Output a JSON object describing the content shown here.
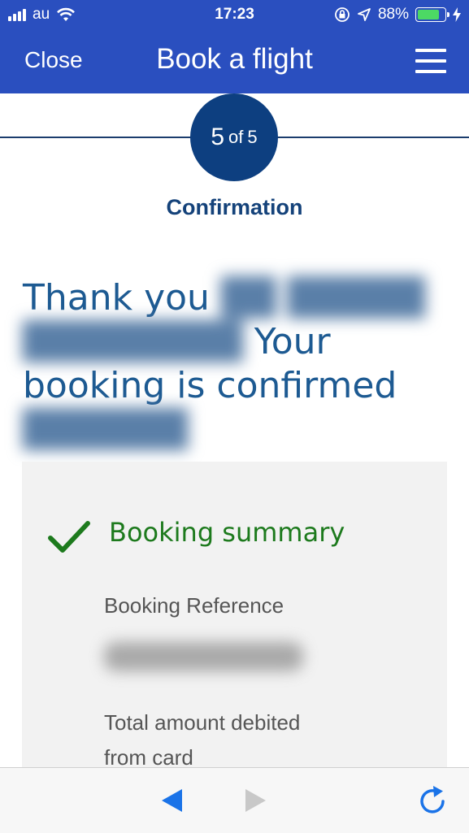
{
  "status_bar": {
    "carrier": "au",
    "time": "17:23",
    "battery_percent": "88%",
    "battery_level": 0.88,
    "icons": [
      "signal-icon",
      "wifi-icon",
      "rotation-lock-icon",
      "location-arrow-icon",
      "battery-icon",
      "charging-bolt-icon"
    ]
  },
  "nav": {
    "close_label": "Close",
    "title": "Book a flight",
    "menu_icon": "hamburger-menu-icon"
  },
  "step": {
    "current": "5",
    "of_label": "of",
    "total": "5",
    "label": "Confirmation"
  },
  "thanks": {
    "text_start": "Thank you",
    "text_mid": "Your booking",
    "text_end": "is confirmed"
  },
  "summary": {
    "title": "Booking summary",
    "check_icon": "checkmark-icon",
    "reference_label": "Booking Reference",
    "total_label": "Total amount debited from card"
  },
  "toolbar": {
    "back_icon": "back-arrow-icon",
    "forward_icon": "forward-arrow-icon",
    "reload_icon": "reload-icon"
  },
  "colors": {
    "brand_blue": "#2a4fbf",
    "step_navy": "#0d3f80",
    "heading_blue": "#1d5a92",
    "success_green": "#1d7a1d",
    "card_bg": "#f2f2f2",
    "toolbar_blue": "#1a73e8"
  }
}
